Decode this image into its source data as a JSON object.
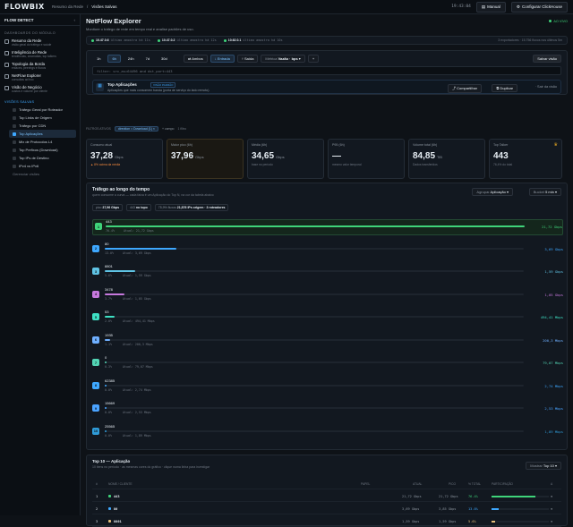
{
  "app": {
    "logo": "FLOWBIX",
    "breadcrumb": [
      "Resumo da Rede",
      "/",
      "Visões Salvas"
    ],
    "time": "19:43:04",
    "manual": "Manual",
    "config": "Configurar ClickHouse",
    "live": "AO VIVO"
  },
  "sidebar": {
    "header": "FLOW DETECT",
    "section1": "DASHBOARDS DO MÓDULO",
    "items": [
      {
        "title": "Resumo da Rede",
        "sub": "visão geral do tráfego e saúde"
      },
      {
        "title": "Inteligência de Rede",
        "sub": "tendências, anomalias, top talkers"
      },
      {
        "title": "Topologia da Borda",
        "sub": "enlaces, peerings e fluxos"
      },
      {
        "title": "NetFlow Explorer",
        "sub": "consultas ad hoc"
      },
      {
        "title": "Visão de Negócio",
        "sub": "custos e volume por cliente"
      }
    ],
    "section2": "VISÕES SALVAS",
    "subitems": [
      "Tráfego Geral por Roteador",
      "Top Links de Origem",
      "Tráfego por CDN",
      "Top Aplicações",
      "Mix de Protocolos L4",
      "Top Prefixos (Download)",
      "Top IPs de Destino",
      "IPv4 vs IPv6"
    ],
    "manage": "Gerenciar visões"
  },
  "header": {
    "title": "NetFlow Explorer",
    "subtitle": "Monitore o tráfego de rede em tempo real e analise padrões de uso."
  },
  "routers": [
    {
      "name": "10.47.0.6",
      "note": "último amostra há 11s"
    },
    {
      "name": "10.47.0.2",
      "note": "último amostra há 12s"
    },
    {
      "name": "10.62.0.1",
      "note": "último amostra há 10s"
    }
  ],
  "routers_right": "3 exportadores · 15.756 fluxos nos últimos 5m",
  "time_tabs": [
    "1h",
    "6h",
    "24h",
    "7d",
    "30d"
  ],
  "active_tab": "6h",
  "filters": {
    "ambos": "Ambos",
    "entrada": "Entrada",
    "saida": "Saída",
    "metric_label": "Métrica",
    "metric_value": "Vazão · bps",
    "save_view": "Salvar visão",
    "query": "filter: src_as=64496 and dst_port=443"
  },
  "view": {
    "title": "Top Aplicações",
    "badge": "VISÃO PADRÃO",
    "desc": "Aplicações que mais consomem banda (porta de serviço do lado remoto).",
    "share": "Compartilhar",
    "duplicate": "Duplicar",
    "delete": "Sair da visão"
  },
  "active_filters": {
    "label": "FILTROS ATIVOS",
    "chip": "direction = Download (1)",
    "add": "+ campo",
    "clear": "1 filtro"
  },
  "kpis": [
    {
      "label": "Consumo atual",
      "value": "37,28",
      "unit": "Gbps",
      "note": "▲ 8% acima da média"
    },
    {
      "label": "Maior pico (6h)",
      "value": "37,96",
      "unit": "Gbps",
      "note": ""
    },
    {
      "label": "Média (6h)",
      "value": "34,65",
      "unit": "Gbps",
      "note": "base no período"
    },
    {
      "label": "P95 (6h)",
      "value": "—",
      "unit": "",
      "note": "mesmo valor temporal"
    },
    {
      "label": "Volume total (6h)",
      "value": "84,85",
      "unit": "TiB",
      "note": "Dados transferidos"
    },
    {
      "label": "Top Talker",
      "value": "443",
      "unit": "",
      "note": "76,4% do total"
    }
  ],
  "traffic": {
    "title": "Tráfego ao longo do tempo",
    "subtitle": "quem consome a curva — cada faixa é um Aplicação do Top N, na cor da tabela abaixo",
    "agrupar_label": "Agrupar",
    "agrupar_value": "Aplicação",
    "bucket_label": "Bucket",
    "bucket_value": "5 min",
    "summary": [
      {
        "k": "pico",
        "v": "37,96 Gbps"
      },
      {
        "k": "443",
        "v": "no topo"
      },
      {
        "k": "75,9% fluxos",
        "v": "21,876 IPs origem · 3 roteadores"
      }
    ]
  },
  "chart_data": {
    "type": "bar",
    "unit": "Gbps",
    "categories": [
      "443",
      "80",
      "8801",
      "3478",
      "53",
      "1935",
      "0",
      "62385",
      "15669",
      "25565"
    ],
    "values": [
      21.72,
      3.69,
      1.59,
      1.05,
      0.000494,
      0.0002,
      7.9e-05,
      2.7e-06,
      2.5e-06,
      1.9e-06
    ],
    "value_labels": [
      "21,72 Gbps",
      "3,69 Gbps",
      "1,59 Gbps",
      "1,05 Gbps",
      "494,41 Mbps",
      "200,3 Mbps",
      "79,07 Mbps",
      "2,74 Mbps",
      "2,53 Mbps",
      "1,89 Mbps"
    ],
    "pct": [
      "76.4%",
      "13.0%",
      "5.6%",
      "3.7%",
      "2.0%",
      "1.1%",
      "0.3%",
      "0.0%",
      "0.0%",
      "0.0%"
    ],
    "atual": [
      "Atual: 21,72 Gbps",
      "Atual: 3,69 Gbps",
      "Atual: 1,59 Gbps",
      "Atual: 1,05 Gbps",
      "Atual: 494,41 Mbps",
      "Atual: 200,3 Mbps",
      "Atual: 79,07 Mbps",
      "Atual: 2,74 Mbps",
      "Atual: 2,53 Mbps",
      "Atual: 1,89 Mbps"
    ],
    "fraction": [
      1,
      0.17,
      0.073,
      0.048,
      0.023,
      0.012,
      0.004,
      0.0002,
      0.0002,
      0.0001
    ],
    "colors": [
      "#3fd47a",
      "#3ea8ff",
      "#5fc3e4",
      "#c678dd",
      "#3ee0c4",
      "#6fb0ff",
      "#53d4b4",
      "#3ea8ff",
      "#4aa3ff",
      "#2f9bd8"
    ]
  },
  "table": {
    "title": "Top 10 — Aplicação",
    "subtitle": "10 itens no período · as mesmas cores do gráfico · clique numa linha para investigar",
    "show_label": "Mostrar",
    "show_value": "Top 10",
    "headers": [
      "#",
      "NOME / CLIENTE",
      "PAPEL",
      "ATUAL",
      "PICO",
      "% TOTAL",
      "PARTICIPAÇÃO"
    ],
    "rows": [
      {
        "rank": "1",
        "name": "443",
        "atual": "21,72 Gbps",
        "pico": "21,72 Gbps",
        "pct": "76.4%",
        "share": 0.764
      },
      {
        "rank": "2",
        "name": "80",
        "atual": "3,69 Gbps",
        "pico": "3,85 Gbps",
        "pct": "13.0%",
        "share": 0.13
      },
      {
        "rank": "3",
        "name": "8801",
        "atual": "1,59 Gbps",
        "pico": "1,59 Gbps",
        "pct": "5.6%",
        "share": 0.056
      }
    ]
  }
}
